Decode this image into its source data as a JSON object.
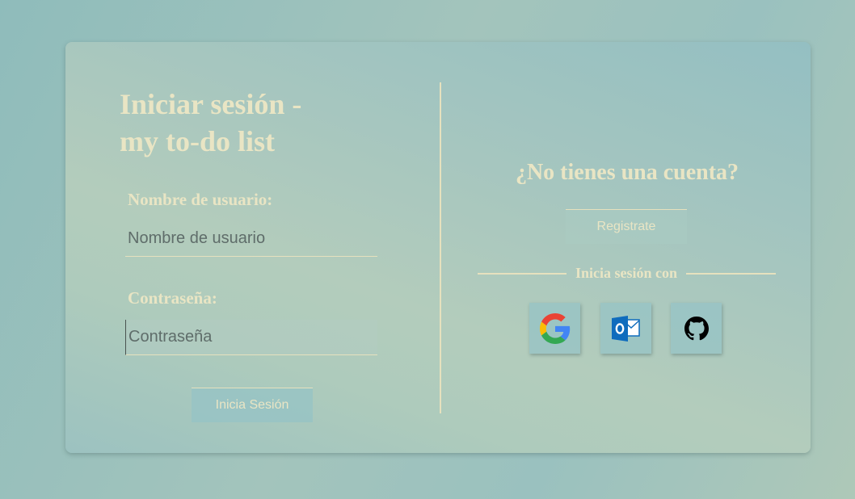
{
  "login": {
    "title_line1": "Iniciar sesión -",
    "title_line2": "my to-do list",
    "username_label": "Nombre de usuario:",
    "username_placeholder": "Nombre de usuario",
    "password_label": "Contraseña:",
    "password_placeholder": "Contraseña",
    "submit_label": "Inicia Sesión"
  },
  "signup": {
    "heading": "¿No tienes una cuenta?",
    "register_label": "Registrate"
  },
  "social": {
    "separator_label": "Inicia sesión con",
    "providers": [
      {
        "icon": "google-icon"
      },
      {
        "icon": "outlook-icon"
      },
      {
        "icon": "github-icon"
      }
    ]
  },
  "colors": {
    "accent_text": "#e9e5c4",
    "card_background": "#a6c6bf",
    "page_background": "#8fbcbb"
  }
}
